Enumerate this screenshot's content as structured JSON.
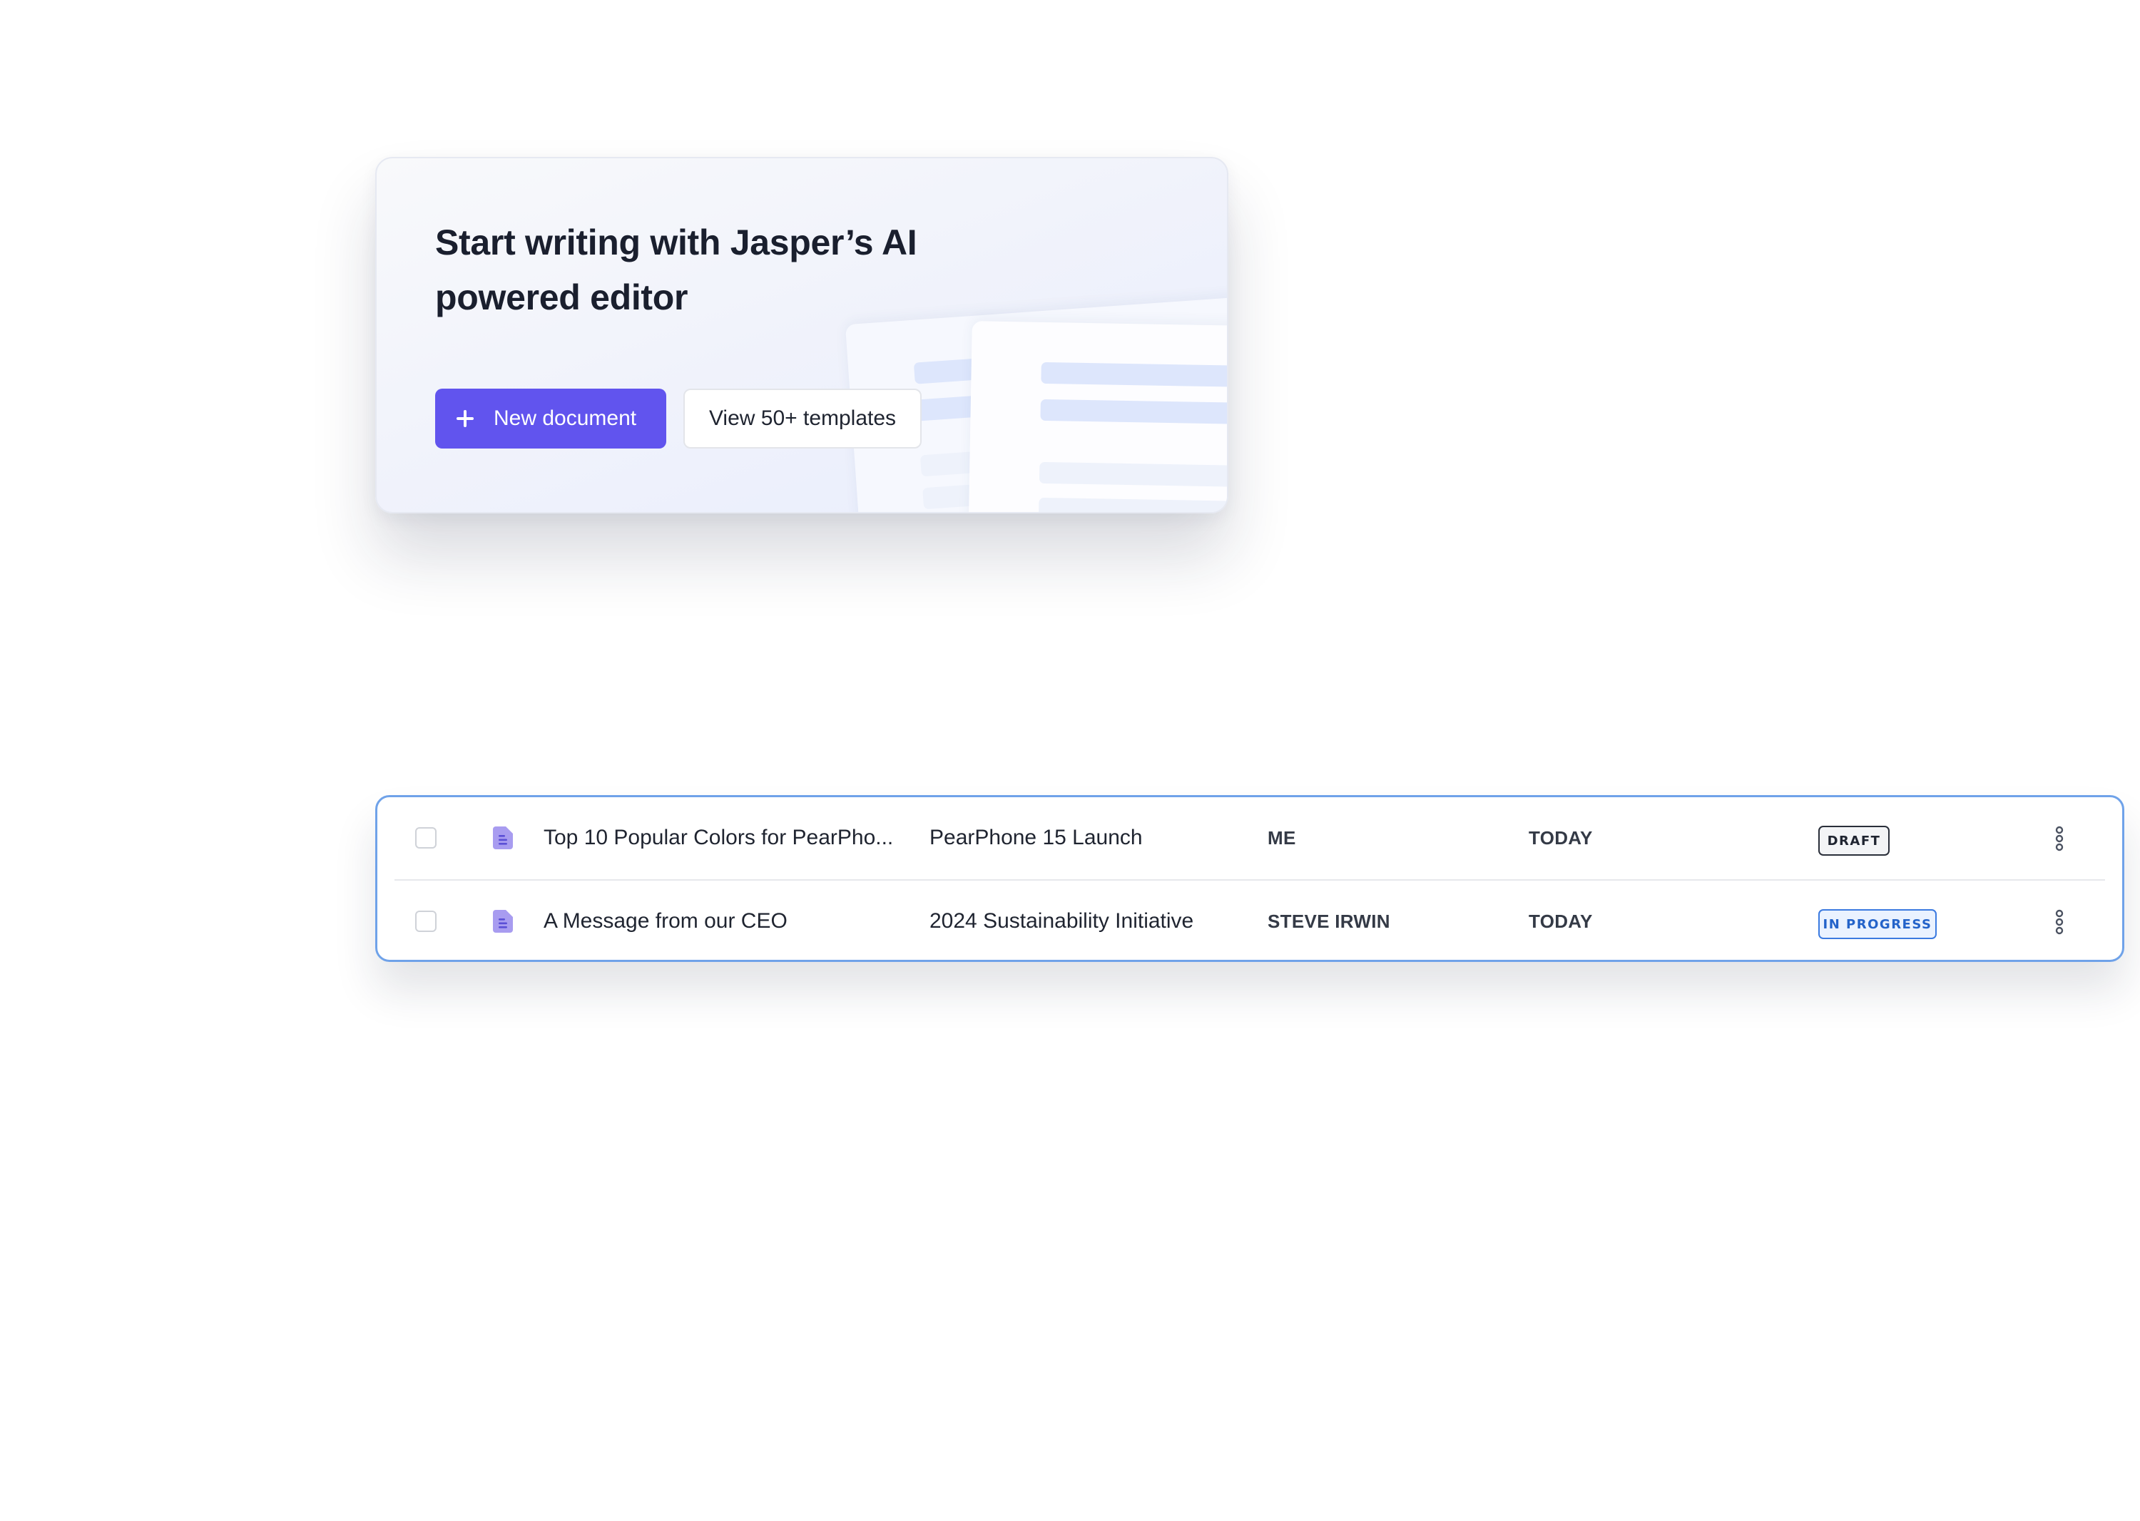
{
  "hero": {
    "title": "Start writing with Jasper’s AI powered editor",
    "primary_button": {
      "label": "New document",
      "icon": "plus-icon",
      "color": "#6154ee"
    },
    "secondary_button": {
      "label": "View 50+ templates"
    }
  },
  "documents": {
    "rows": [
      {
        "title": "Top 10 Popular Colors for PearPho...",
        "project": "PearPhone 15 Launch",
        "owner": "ME",
        "date": "TODAY",
        "status": "DRAFT",
        "icon": "document-icon"
      },
      {
        "title": "A Message from our CEO",
        "project": "2024 Sustainability Initiative",
        "owner": "STEVE IRWIN",
        "date": "TODAY",
        "status": "IN PROGRESS",
        "icon": "document-icon"
      }
    ],
    "colors": {
      "border": "#6fa2e9",
      "in_progress": "#2463c9",
      "draft": "#1f2430"
    }
  }
}
